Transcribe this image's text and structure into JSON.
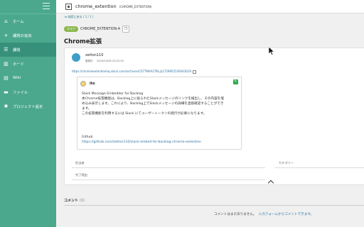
{
  "sidebar": {
    "items": [
      {
        "label": "ホーム",
        "icon": "home-icon",
        "glyph": "⌂"
      },
      {
        "label": "課題の追加",
        "icon": "plus-icon",
        "glyph": "+"
      },
      {
        "label": "課題",
        "icon": "list-icon",
        "glyph": "☰"
      },
      {
        "label": "ボード",
        "icon": "board-icon",
        "glyph": "▥"
      },
      {
        "label": "Wiki",
        "icon": "wiki-icon",
        "glyph": "▤"
      },
      {
        "label": "ファイル",
        "icon": "folder-icon",
        "glyph": "▬"
      },
      {
        "label": "プロジェクト設定",
        "icon": "gear-icon",
        "glyph": "✺"
      }
    ]
  },
  "header": {
    "project_name": "chrome_extention",
    "project_key": "(CHROME_EXTENTION)"
  },
  "issue": {
    "back_link": "⇆ 検索に戻る ( 1 / 1 )",
    "type_badge": "タスク",
    "key": "CHROME_EXTENTION-4",
    "title": "Chrome拡張",
    "author": "zetton110",
    "registered_label": "登録日",
    "registered_date": "2024/10/26 23:22:43",
    "url": "https://chromeextentionhq.slack.com/archives/C07TMAA1TKL/p1729952539343019",
    "embed": {
      "user": "ito",
      "line1": "Slack Message Embedder for Backlog",
      "line2": "本Chrome拡張機能は、Backlog上に貼られたSlackメッセージのリンクを検出し、その内容を埋",
      "line3": "め込み表示します。これにより、Backlog上でSlackメッセージの詳細を直接確認することができ",
      "line4": "ます。",
      "line5": "この拡張機能を利用するには Slack にてユーザートークンの発行が必要になります。",
      "github_label": "Github",
      "github_url": "https://github.com/zetton110/slack-embed-for-backlog-chrome-extention"
    },
    "fields": {
      "assignee": "担当者",
      "category": "カテゴリー",
      "resolution": "完了理由"
    }
  },
  "comments": {
    "title": "コメント",
    "count": "(0)",
    "empty_text": "コメントはまだありません。",
    "empty_link": "入力フォームからコメントできます。"
  },
  "colors": {
    "sidebar": "#4ba88c",
    "sidebar_active": "#37917a",
    "task_badge": "#8bb84d",
    "link": "#2b6fa0"
  }
}
